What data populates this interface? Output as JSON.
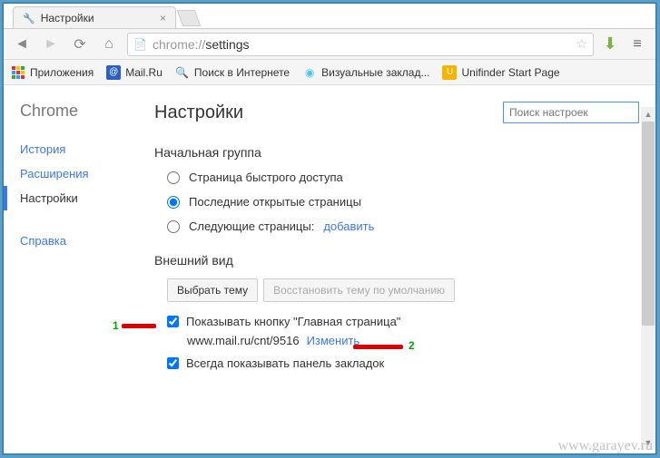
{
  "window": {
    "min": "—",
    "max": "▭",
    "close": "✕"
  },
  "tab": {
    "title": "Настройки"
  },
  "url": {
    "scheme": "chrome://",
    "host": "settings"
  },
  "bookmarks": {
    "apps": "Приложения",
    "items": [
      {
        "label": "Mail.Ru",
        "icon_color": "#2a60c8"
      },
      {
        "label": "Поиск в Интернете",
        "icon_color": "#f5b400"
      },
      {
        "label": "Визуальные заклад...",
        "icon_color": "#4fc3f7"
      },
      {
        "label": "Unifinder Start Page",
        "icon_color": "#f5b400"
      }
    ]
  },
  "sidebar": {
    "brand": "Chrome",
    "items": [
      {
        "label": "История"
      },
      {
        "label": "Расширения"
      },
      {
        "label": "Настройки"
      },
      {
        "label": "Справка"
      }
    ]
  },
  "main": {
    "title": "Настройки",
    "search_placeholder": "Поиск настроек",
    "startup": {
      "title": "Начальная группа",
      "opt1": "Страница быстрого доступа",
      "opt2": "Последние открытые страницы",
      "opt3": "Следующие страницы:",
      "add_link": "добавить"
    },
    "appearance": {
      "title": "Внешний вид",
      "choose_theme": "Выбрать тему",
      "reset_theme": "Восстановить тему по умолчанию",
      "show_home": "Показывать кнопку \"Главная страница\"",
      "home_url": "www.mail.ru/cnt/9516",
      "change_link": "Изменить",
      "show_bookmarks": "Всегда показывать панель закладок"
    }
  },
  "annotations": {
    "n1": "1",
    "n2": "2"
  },
  "watermark": "www.garayev.ru"
}
